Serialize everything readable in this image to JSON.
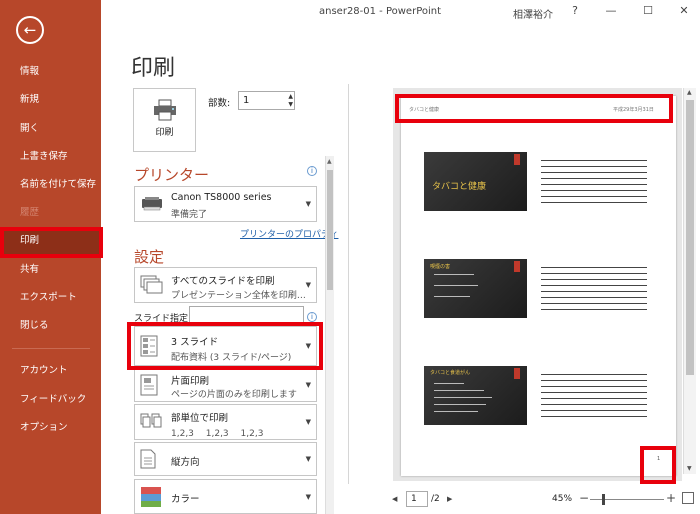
{
  "window": {
    "title": "anser28-01 - PowerPoint",
    "user": "相澤裕介",
    "help": "?"
  },
  "sidebar": {
    "items": [
      {
        "label": "情報"
      },
      {
        "label": "新規"
      },
      {
        "label": "開く"
      },
      {
        "label": "上書き保存"
      },
      {
        "label": "名前を付けて保存"
      },
      {
        "label": "履歴"
      },
      {
        "label": "印刷"
      },
      {
        "label": "共有"
      },
      {
        "label": "エクスポート"
      },
      {
        "label": "閉じる"
      },
      {
        "label": "アカウント"
      },
      {
        "label": "フィードバック"
      },
      {
        "label": "オプション"
      }
    ]
  },
  "page": {
    "title": "印刷"
  },
  "print": {
    "button_label": "印刷",
    "copies_label": "部数:",
    "copies_value": "1"
  },
  "printer": {
    "heading": "プリンター",
    "name": "Canon TS8000 series",
    "status": "準備完了",
    "properties_link": "プリンターのプロパティ"
  },
  "settings": {
    "heading": "設定",
    "range": {
      "main": "すべてのスライドを印刷",
      "sub": "プレゼンテーション全体を印刷…"
    },
    "slide_spec_label": "スライド指定:",
    "layout": {
      "main": "3 スライド",
      "sub": "配布資料 (3 スライド/ページ)"
    },
    "sides": {
      "main": "片面印刷",
      "sub": "ページの片面のみを印刷します"
    },
    "collate": {
      "main": "部単位で印刷",
      "sub": "1,2,3　 1,2,3　 1,2,3"
    },
    "orientation": {
      "main": "縦方向"
    },
    "color": {
      "main": "カラー"
    }
  },
  "preview": {
    "header_left": "タバコと健康",
    "header_right": "平成29年3月31日",
    "page_number": "1",
    "slides": [
      {
        "title": "タバコと健康"
      },
      {
        "title": "喫煙の害"
      },
      {
        "title": "タバコと食道がん"
      }
    ]
  },
  "nav": {
    "current_page": "1",
    "total": "/2"
  },
  "zoom": {
    "level": "45%",
    "fraction": 0.18
  },
  "colors": {
    "accent": "#b7472a",
    "highlight": "#e8000c"
  }
}
